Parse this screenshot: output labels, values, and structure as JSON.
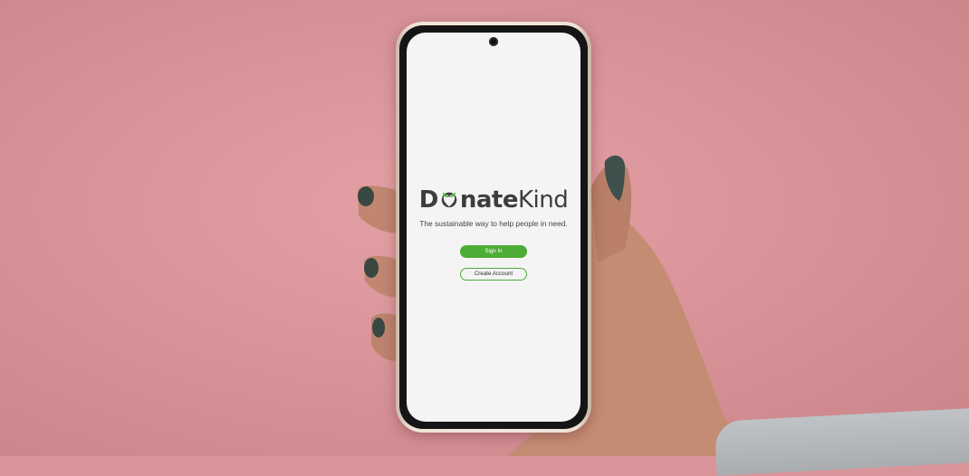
{
  "app": {
    "logo_prefix_d": "D",
    "logo_bold_rest": "nate",
    "logo_light": "Kind",
    "tagline": "The sustainable way to help people in need."
  },
  "buttons": {
    "sign_in": "Sign In",
    "create_account": "Create Account"
  },
  "icons": {
    "logo_o": "leaf-heart-icon",
    "camera": "front-camera-icon"
  },
  "colors": {
    "brand_green": "#4cad36",
    "logo_text": "#3d3d3d",
    "screen_bg": "#f4f4f4",
    "backdrop": "#d9959a"
  }
}
